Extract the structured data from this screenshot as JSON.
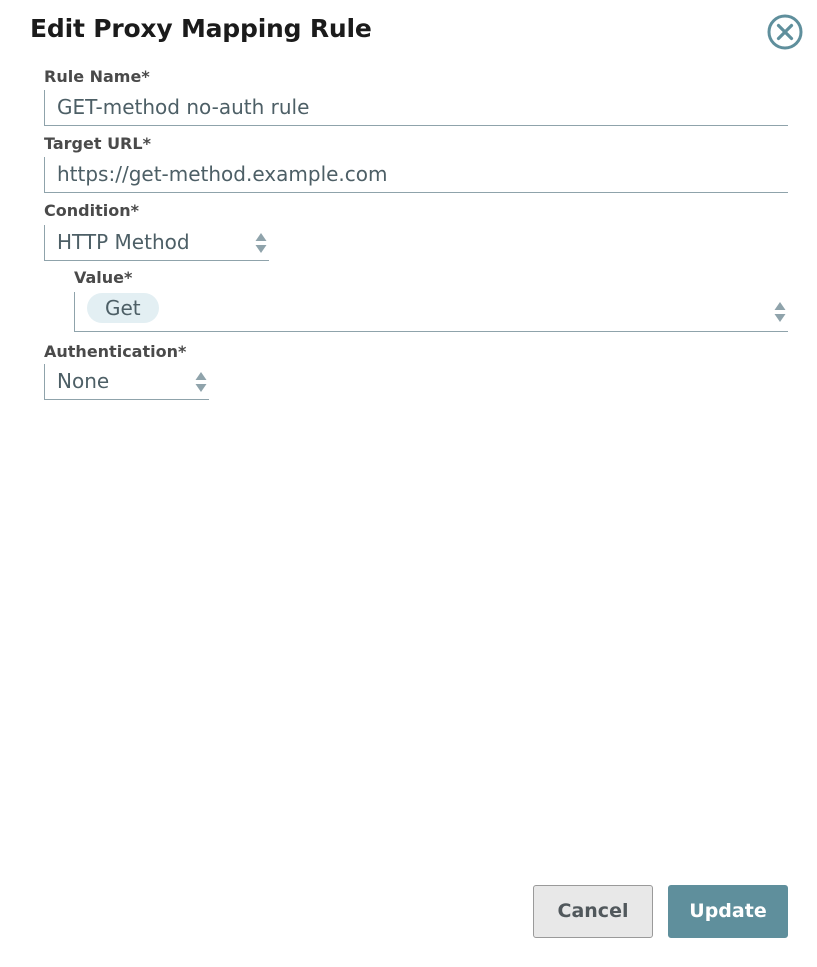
{
  "dialog": {
    "title": "Edit Proxy Mapping Rule",
    "close_icon": "close-circle-icon"
  },
  "form": {
    "rule_name": {
      "label": "Rule Name*",
      "value": "GET-method no-auth rule"
    },
    "target_url": {
      "label": "Target URL*",
      "value": "https://get-method.example.com"
    },
    "condition": {
      "label": "Condition*",
      "selected": "HTTP Method"
    },
    "value": {
      "label": "Value*",
      "tags": [
        "Get"
      ]
    },
    "authentication": {
      "label": "Authentication*",
      "selected": "None"
    }
  },
  "actions": {
    "cancel_label": "Cancel",
    "update_label": "Update"
  },
  "colors": {
    "accent": "#5f8f9c",
    "field_border": "#8fa3ab",
    "field_text": "#4d5f66",
    "chip_bg": "#e3eff3",
    "label_text": "#4a4a4a"
  }
}
